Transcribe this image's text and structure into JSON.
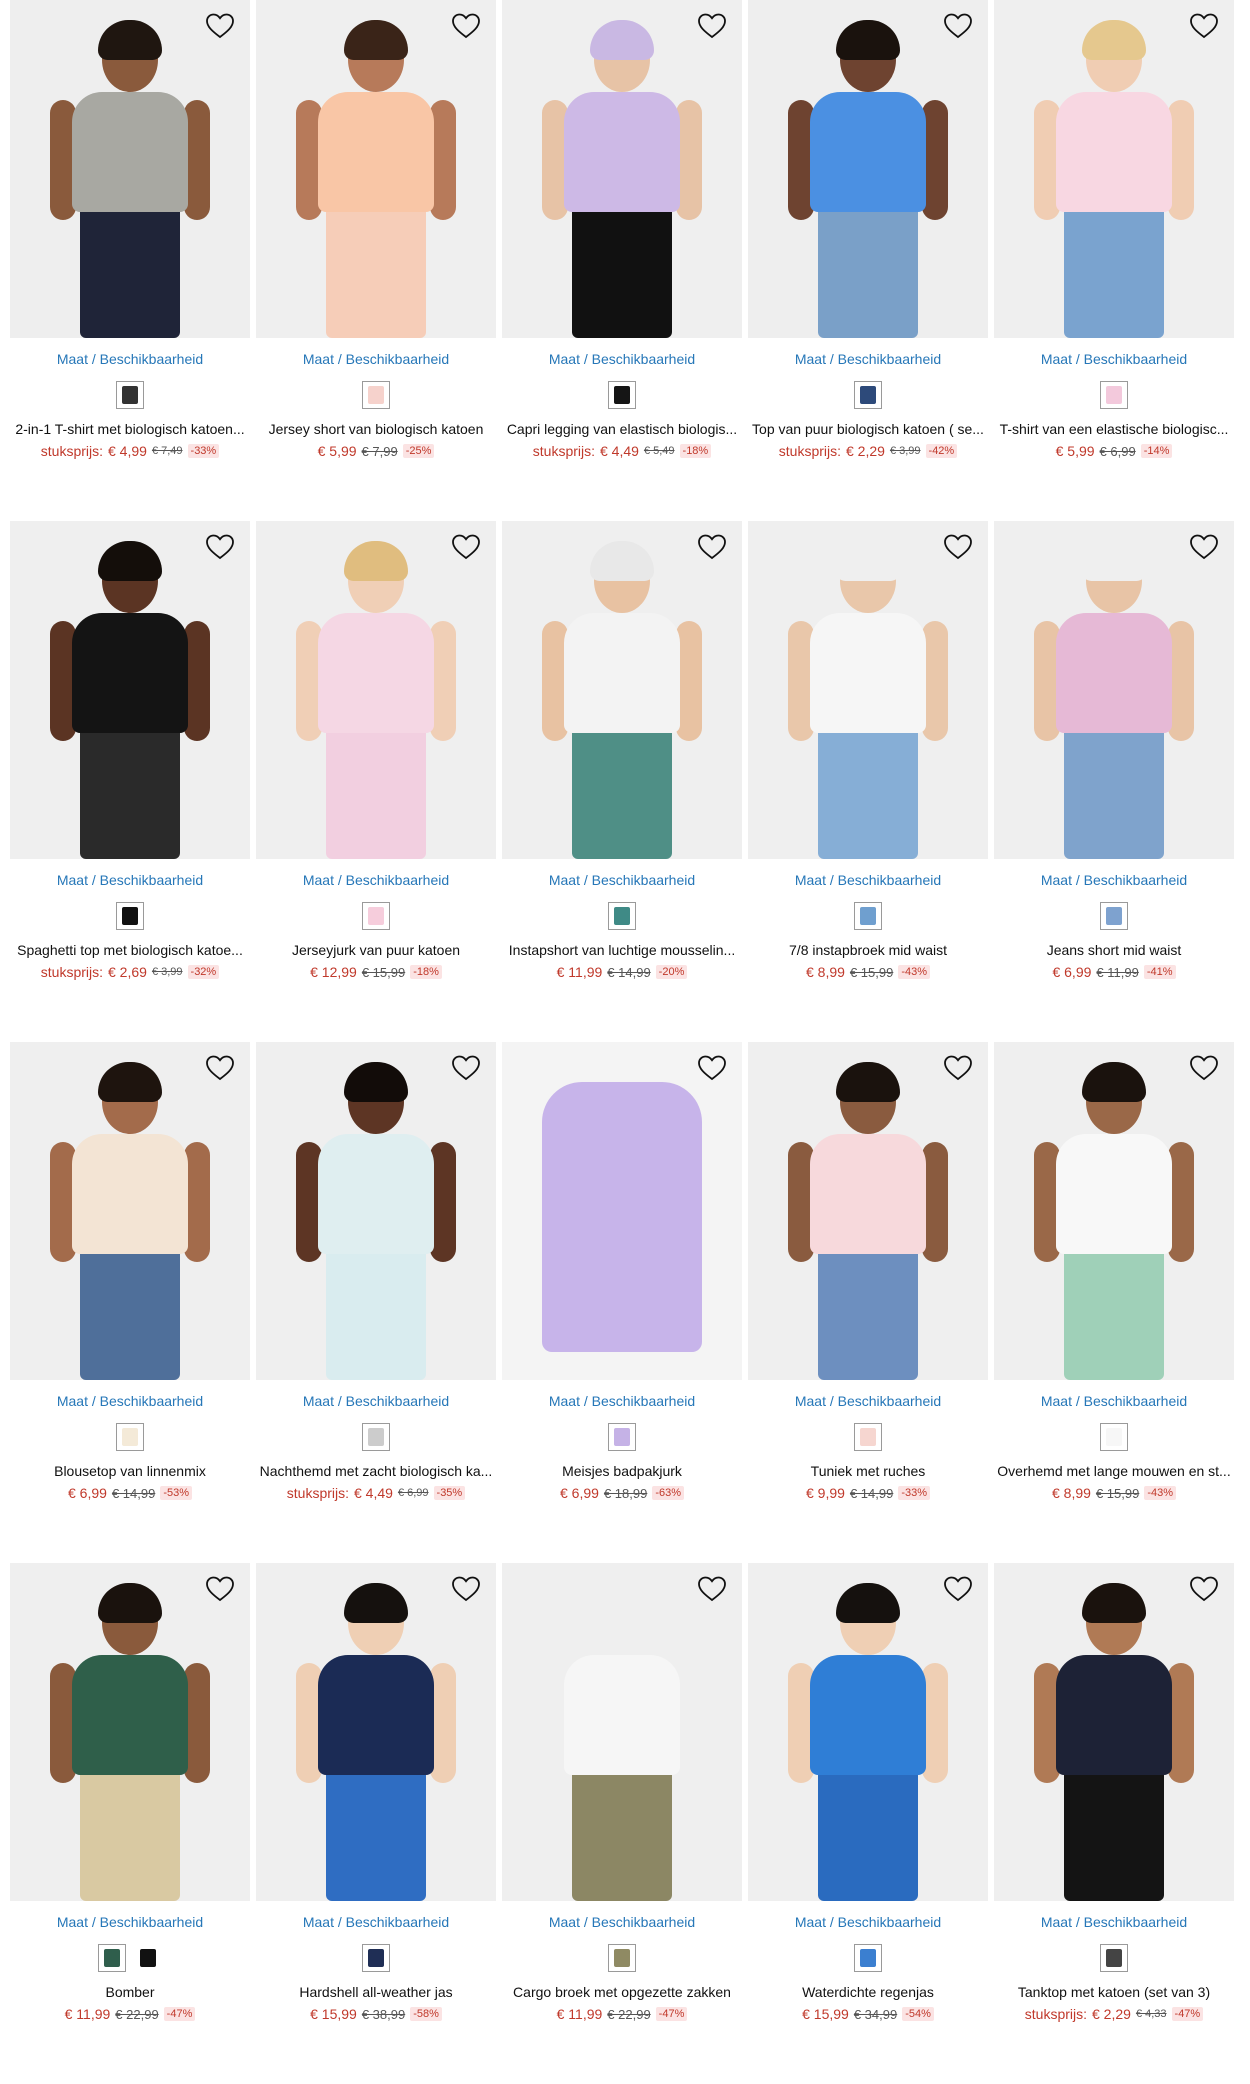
{
  "availability_label": "Maat / Beschikbaarheid",
  "products": [
    {
      "title": "2-in-1 T-shirt met biologisch katoen...",
      "label": "stuksprijs:",
      "price": "€ 4,99",
      "old_price": "€ 7,49",
      "discount": "-33%",
      "swatches": [
        {
          "color": "#333333"
        }
      ],
      "look": {
        "skin": "#8a5a3c",
        "hair": "#1f1610",
        "top": "#a8a8a2",
        "bottom": "#1f2438",
        "bg": "#eeeeee"
      }
    },
    {
      "title": "Jersey short van biologisch katoen",
      "label": "",
      "price": "€ 5,99",
      "old_price": "€ 7,99",
      "discount": "-25%",
      "swatches": [
        {
          "color": "#f6d2cc"
        }
      ],
      "look": {
        "skin": "#b77a5a",
        "hair": "#3a2418",
        "top": "#f9c6a6",
        "bottom": "#f6cdb8",
        "bg": "#efefef"
      }
    },
    {
      "title": "Capri legging van elastisch biologis...",
      "label": "stuksprijs:",
      "price": "€ 4,49",
      "old_price": "€ 5,49",
      "discount": "-18%",
      "swatches": [
        {
          "color": "#151515"
        }
      ],
      "look": {
        "skin": "#e7c3a6",
        "hair": "#c9b8e3",
        "top": "#cdb9e6",
        "bottom": "#111111",
        "bg": "#efefef"
      }
    },
    {
      "title": "Top van puur biologisch katoen ( se...",
      "label": "stuksprijs:",
      "price": "€ 2,29",
      "old_price": "€ 3,99",
      "discount": "-42%",
      "swatches": [
        {
          "color": "#2d4a7a"
        }
      ],
      "look": {
        "skin": "#6e4330",
        "hair": "#1a120d",
        "top": "#4b90e2",
        "bottom": "#7aa0c8",
        "bg": "#eeeeee"
      }
    },
    {
      "title": "T-shirt van een elastische biologisc...",
      "label": "",
      "price": "€ 5,99",
      "old_price": "€ 6,99",
      "discount": "-14%",
      "swatches": [
        {
          "color": "#f3c9dc"
        }
      ],
      "look": {
        "skin": "#f0cdb3",
        "hair": "#e5c88e",
        "top": "#f8d7e2",
        "bottom": "#7aa3cf",
        "bg": "#efefef"
      }
    },
    {
      "title": "Spaghetti top met biologisch katoe...",
      "label": "stuksprijs:",
      "price": "€ 2,69",
      "old_price": "€ 3,99",
      "discount": "-32%",
      "swatches": [
        {
          "color": "#111111"
        }
      ],
      "look": {
        "skin": "#5b3423",
        "hair": "#140e0a",
        "top": "#141414",
        "bottom": "#2a2a2a",
        "bg": "#efefef"
      }
    },
    {
      "title": "Jerseyjurk van puur katoen",
      "label": "",
      "price": "€ 12,99",
      "old_price": "€ 15,99",
      "discount": "-18%",
      "swatches": [
        {
          "color": "#f6cddc"
        }
      ],
      "look": {
        "skin": "#f0cfb6",
        "hair": "#e0bd7f",
        "top": "#f5d7e4",
        "bottom": "#f2cfe0",
        "bg": "#efefef"
      }
    },
    {
      "title": "Instapshort van luchtige mousselin...",
      "label": "",
      "price": "€ 11,99",
      "old_price": "€ 14,99",
      "discount": "-20%",
      "swatches": [
        {
          "color": "#3f8a86"
        }
      ],
      "look": {
        "skin": "#e8c2a2",
        "hair": "#e8e8e8",
        "top": "#f3f3f3",
        "bottom": "#4f8f86",
        "bg": "#efefef"
      }
    },
    {
      "title": "7/8 instapbroek mid waist",
      "label": "",
      "price": "€ 8,99",
      "old_price": "€ 15,99",
      "discount": "-43%",
      "swatches": [
        {
          "color": "#6f9fcf"
        }
      ],
      "look": {
        "skin": "#e9c7aa",
        "hair": "#efefef",
        "top": "#f6f6f6",
        "bottom": "#86aed6",
        "bg": "#efefef"
      }
    },
    {
      "title": "Jeans short mid waist",
      "label": "",
      "price": "€ 6,99",
      "old_price": "€ 11,99",
      "discount": "-41%",
      "swatches": [
        {
          "color": "#7ea2cf"
        }
      ],
      "look": {
        "skin": "#e8c4a6",
        "hair": "#efefef",
        "top": "#e6b9d6",
        "bottom": "#7fa3cc",
        "bg": "#efefef"
      }
    },
    {
      "title": "Blousetop van linnenmix",
      "label": "",
      "price": "€ 6,99",
      "old_price": "€ 14,99",
      "discount": "-53%",
      "swatches": [
        {
          "color": "#f4ead8"
        }
      ],
      "look": {
        "skin": "#a36b4b",
        "hair": "#1e140e",
        "top": "#f3e4d4",
        "bottom": "#4f6f9a",
        "bg": "#efefef"
      }
    },
    {
      "title": "Nachthemd met zacht biologisch ka...",
      "label": "stuksprijs:",
      "price": "€ 4,49",
      "old_price": "€ 6,99",
      "discount": "-35%",
      "swatches": [
        {
          "color": "#cccccc"
        }
      ],
      "look": {
        "skin": "#5d3524",
        "hair": "#120c09",
        "top": "#dfeef0",
        "bottom": "#d9ecef",
        "bg": "#efefef"
      }
    },
    {
      "title": "Meisjes badpakjurk",
      "label": "",
      "price": "€ 6,99",
      "old_price": "€ 18,99",
      "discount": "-63%",
      "swatches": [
        {
          "color": "#c5b2e6"
        }
      ],
      "look": {
        "skin": "#f3f3f3",
        "hair": "#f3f3f3",
        "top": "#c7b4ea",
        "bottom": "#c0ade6",
        "bg": "#f4f4f4"
      }
    },
    {
      "title": "Tuniek met ruches",
      "label": "",
      "price": "€ 9,99",
      "old_price": "€ 14,99",
      "discount": "-33%",
      "swatches": [
        {
          "color": "#f6d6d0"
        }
      ],
      "look": {
        "skin": "#8a5b3f",
        "hair": "#1a120d",
        "top": "#f7d9dc",
        "bottom": "#6d8fbf",
        "bg": "#efefef"
      }
    },
    {
      "title": "Overhemd met lange mouwen en st...",
      "label": "",
      "price": "€ 8,99",
      "old_price": "€ 15,99",
      "discount": "-43%",
      "swatches": [
        {
          "color": "#f7f7f7"
        }
      ],
      "look": {
        "skin": "#9a6848",
        "hair": "#1a120d",
        "top": "#f8f8f8",
        "bottom": "#9fd0b8",
        "bg": "#efefef"
      }
    },
    {
      "title": "Bomber",
      "label": "",
      "price": "€ 11,99",
      "old_price": "€ 22,99",
      "discount": "-47%",
      "swatches": [
        {
          "color": "#2f5e4c"
        },
        {
          "color": "#111111",
          "plain": true
        }
      ],
      "look": {
        "skin": "#8a5a3c",
        "hair": "#1a120d",
        "top": "#2f5f4a",
        "bottom": "#d9c9a2",
        "bg": "#efefef"
      }
    },
    {
      "title": "Hardshell all-weather jas",
      "label": "",
      "price": "€ 15,99",
      "old_price": "€ 38,99",
      "discount": "-58%",
      "swatches": [
        {
          "color": "#1f2e55"
        }
      ],
      "look": {
        "skin": "#efcfb4",
        "hair": "#15110e",
        "top": "#1b2b55",
        "bottom": "#2f6dc2",
        "bg": "#efefef"
      }
    },
    {
      "title": "Cargo broek met opgezette zakken",
      "label": "",
      "price": "€ 11,99",
      "old_price": "€ 22,99",
      "discount": "-47%",
      "swatches": [
        {
          "color": "#8f8a63"
        }
      ],
      "look": {
        "skin": "#efefef",
        "hair": "#efefef",
        "top": "#f6f6f6",
        "bottom": "#8c8764",
        "bg": "#efefef"
      }
    },
    {
      "title": "Waterdichte regenjas",
      "label": "",
      "price": "€ 15,99",
      "old_price": "€ 34,99",
      "discount": "-54%",
      "swatches": [
        {
          "color": "#3b7fd0"
        }
      ],
      "look": {
        "skin": "#efcfb4",
        "hair": "#15110e",
        "top": "#2f7ed6",
        "bottom": "#2a6bbf",
        "bg": "#efefef"
      }
    },
    {
      "title": "Tanktop met katoen (set van 3)",
      "label": "stuksprijs:",
      "price": "€ 2,29",
      "old_price": "€ 4,33",
      "discount": "-47%",
      "swatches": [
        {
          "color": "#444444"
        }
      ],
      "look": {
        "skin": "#b07a55",
        "hair": "#1a120d",
        "top": "#1d2236",
        "bottom": "#141414",
        "bg": "#efefef"
      }
    }
  ]
}
